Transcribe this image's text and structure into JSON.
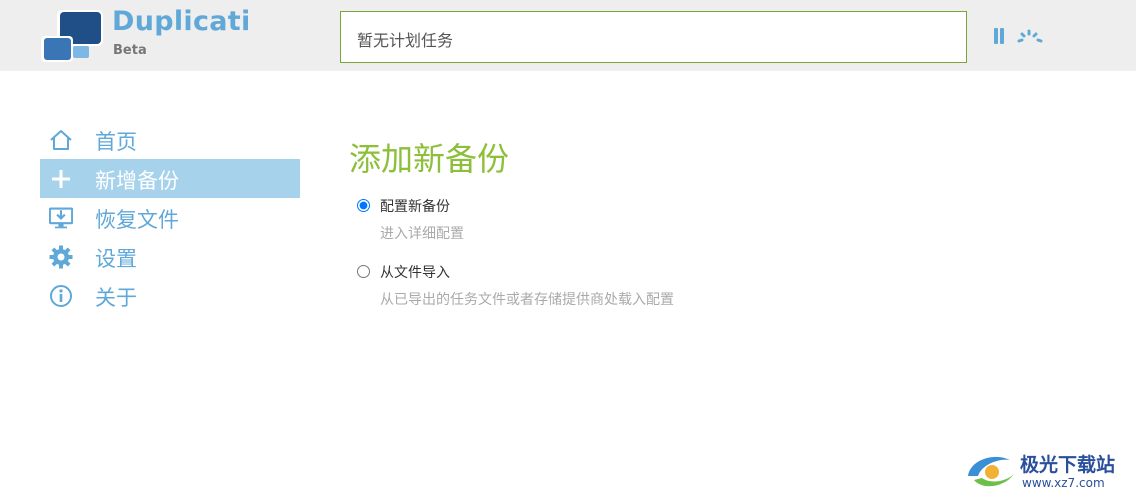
{
  "app": {
    "name": "Duplicati",
    "edition": "Beta"
  },
  "header": {
    "status_text": "暂无计划任务",
    "pause_icon": "pause-icon",
    "throttle_icon": "throttle-gauge-icon"
  },
  "sidebar": {
    "items": [
      {
        "label": "首页",
        "icon": "home-icon",
        "active": false
      },
      {
        "label": "新增备份",
        "icon": "plus-icon",
        "active": true
      },
      {
        "label": "恢复文件",
        "icon": "restore-monitor-icon",
        "active": false
      },
      {
        "label": "设置",
        "icon": "gear-icon",
        "active": false
      },
      {
        "label": "关于",
        "icon": "info-icon",
        "active": false
      }
    ]
  },
  "main": {
    "title": "添加新备份",
    "options": [
      {
        "label": "配置新备份",
        "description": "进入详细配置",
        "selected": true
      },
      {
        "label": "从文件导入",
        "description": "从已导出的任务文件或者存储提供商处载入配置",
        "selected": false
      }
    ]
  },
  "watermark": {
    "text": "极光下载站",
    "url": "www.xz7.com"
  },
  "colors": {
    "accent_blue": "#5fa8d8",
    "active_bg": "#a7d2ec",
    "title_green": "#8dbf3a",
    "status_border": "#79a53a",
    "header_bg": "#eeeeee"
  }
}
